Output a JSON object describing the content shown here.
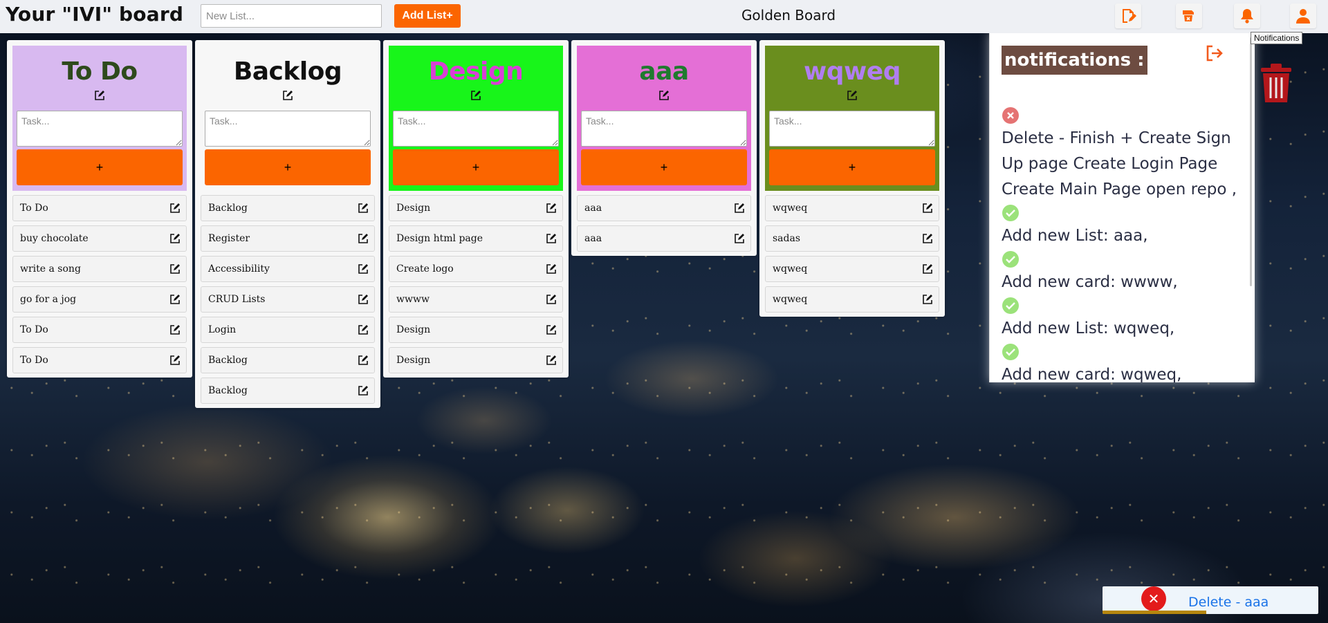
{
  "header": {
    "brand": "Your \"IVI\" board",
    "new_list_placeholder": "New List...",
    "add_list_label": "Add List+",
    "board_name": "Golden Board",
    "tooltip": "Notifications",
    "icons": [
      "edit-board-icon",
      "delete-board-icon",
      "bell-icon",
      "user-icon"
    ],
    "accent_color": "#fb6500"
  },
  "lists": [
    {
      "title": "To Do",
      "header_color": "#d8b9f0",
      "title_color": "#2e4a1c",
      "task_placeholder": "Task...",
      "add_label": "+",
      "cards": [
        "To Do",
        "buy chocolate",
        "write a song",
        "go for a jog",
        "To Do",
        "To Do"
      ]
    },
    {
      "title": "Backlog",
      "header_color": "#f7f7f7",
      "title_color": "#111111",
      "task_placeholder": "Task...",
      "add_label": "+",
      "cards": [
        "Backlog",
        "Register",
        "Accessibility",
        "CRUD Lists",
        "Login",
        "Backlog",
        "Backlog"
      ]
    },
    {
      "title": "Design",
      "header_color": "#18f51a",
      "title_color": "#d93fd6",
      "task_placeholder": "Task...",
      "add_label": "+",
      "cards": [
        "Design",
        "Design html page",
        "Create logo",
        "wwww",
        "Design",
        "Design"
      ]
    },
    {
      "title": "aaa",
      "header_color": "#e46fd6",
      "title_color": "#1f7a2e",
      "task_placeholder": "Task...",
      "add_label": "+",
      "cards": [
        "aaa",
        "aaa"
      ]
    },
    {
      "title": "wqweq",
      "header_color": "#6a8e1e",
      "title_color": "#b07ef0",
      "task_placeholder": "Task...",
      "add_label": "+",
      "cards": [
        "wqweq",
        "sadas",
        "wqweq",
        "wqweq"
      ]
    }
  ],
  "notifications": {
    "title": "notifications :",
    "items": [
      {
        "status": "error",
        "text": "Delete - Finish + Create Sign Up page Create Login Page Create Main Page open repo ,"
      },
      {
        "status": "success",
        "text": "Add new List: aaa,"
      },
      {
        "status": "success",
        "text": "Add new card: wwww,"
      },
      {
        "status": "success",
        "text": "Add new List: wqweq,"
      },
      {
        "status": "success",
        "text": "Add new card: wqweq,"
      }
    ],
    "error_color": "#e57373",
    "success_color": "#9be27a"
  },
  "toast": {
    "icon": "close-icon",
    "text": "Delete - aaa",
    "progress": 0.48
  }
}
